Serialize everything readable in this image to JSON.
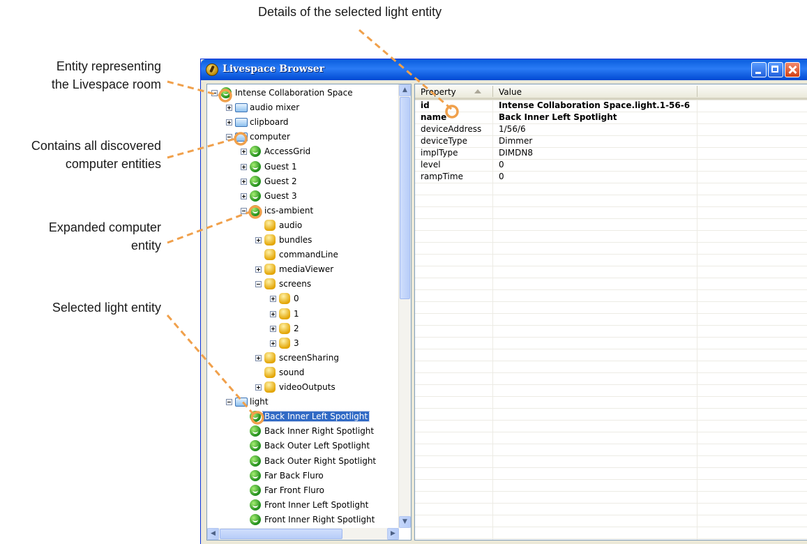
{
  "annotations": {
    "top": "Details of the selected  light entity",
    "entity_room": [
      "Entity representing",
      "the Livespace room"
    ],
    "computer_entities": [
      "Contains all discovered",
      "computer entities"
    ],
    "expanded": [
      "Expanded computer",
      "entity"
    ],
    "selected": "Selected light entity"
  },
  "window": {
    "title": "Livespace Browser"
  },
  "tree": [
    "Intense Collaboration Space",
    "audio mixer",
    "clipboard",
    "computer",
    "AccessGrid",
    "Guest 1",
    "Guest 2",
    "Guest 3",
    "ics-ambient",
    "audio",
    "bundles",
    "commandLine",
    "mediaViewer",
    "screens",
    "0",
    "1",
    "2",
    "3",
    "screenSharing",
    "sound",
    "videoOutputs",
    "light",
    "Back Inner Left Spotlight",
    "Back Inner Right Spotlight",
    "Back Outer Left Spotlight",
    "Back Outer Right Spotlight",
    "Far Back Fluro",
    "Far Front Fluro",
    "Front Inner Left Spotlight",
    "Front Inner Right Spotlight"
  ],
  "table": {
    "col_property": "Property",
    "col_value": "Value",
    "rows": [
      {
        "property": "id",
        "value": "Intense Collaboration Space.light.1-56-6"
      },
      {
        "property": "name",
        "value": "Back Inner Left Spotlight"
      },
      {
        "property": "deviceAddress",
        "value": "1/56/6"
      },
      {
        "property": "deviceType",
        "value": "Dimmer"
      },
      {
        "property": "implType",
        "value": "DIMDN8"
      },
      {
        "property": "level",
        "value": "0"
      },
      {
        "property": "rampTime",
        "value": "0"
      }
    ]
  },
  "colors": {
    "annotation_line": "#f0a04b",
    "selection": "#316ac5",
    "titlebar": "#0a5ddd"
  },
  "icons": {
    "folder": "folder-icon",
    "globe": "globe-icon",
    "cube": "cube-icon"
  }
}
